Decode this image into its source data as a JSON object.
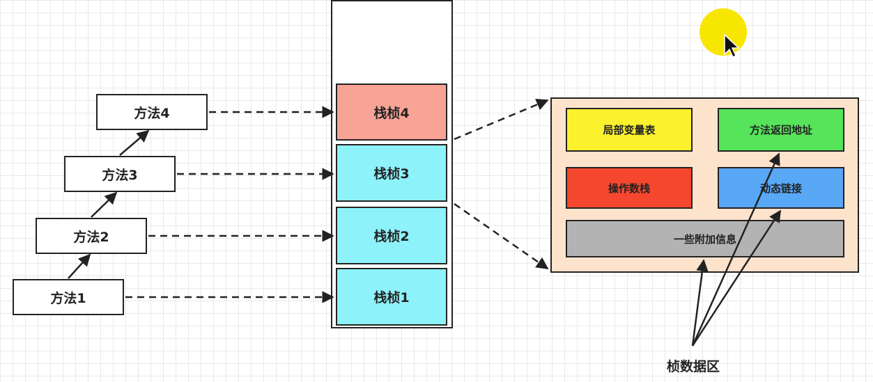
{
  "methods": [
    {
      "label": "方法1"
    },
    {
      "label": "方法2"
    },
    {
      "label": "方法3"
    },
    {
      "label": "方法4"
    }
  ],
  "frames": [
    {
      "label": "栈桢1",
      "color": "#8ef2fb"
    },
    {
      "label": "栈桢2",
      "color": "#8ef2fb"
    },
    {
      "label": "栈桢3",
      "color": "#8ef2fb"
    },
    {
      "label": "栈桢4",
      "color": "#f7a396"
    }
  ],
  "frame_detail": {
    "background": "#fde3cc",
    "parts": [
      {
        "label": "局部变量表",
        "color": "#fbf12c"
      },
      {
        "label": "方法返回地址",
        "color": "#56e45a"
      },
      {
        "label": "操作数栈",
        "color": "#f4472e"
      },
      {
        "label": "动态链接",
        "color": "#58a8f6"
      },
      {
        "label": "一些附加信息",
        "color": "#b3b3b3"
      }
    ]
  },
  "caption": "桢数据区",
  "cursor": {
    "icon": "pointer-cursor-icon",
    "highlight_color": "#f7e600"
  }
}
